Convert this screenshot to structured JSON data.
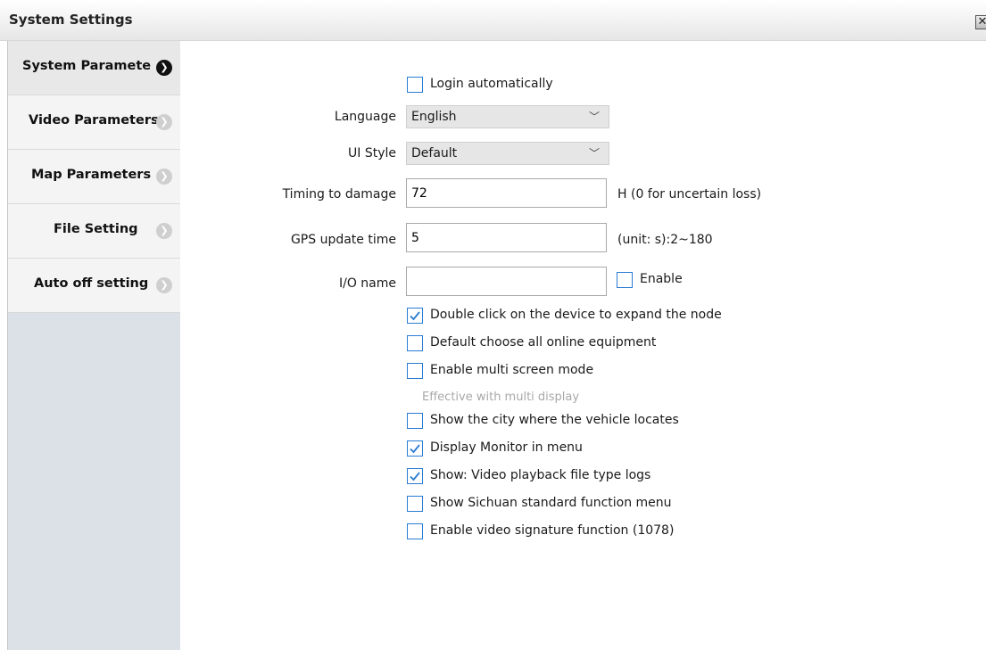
{
  "window": {
    "title": "System Settings",
    "close_glyph": "✕"
  },
  "sidebar": {
    "items": [
      {
        "label": "System Paramete",
        "active": true
      },
      {
        "label": "Video Parameters",
        "active": false
      },
      {
        "label": "Map Parameters",
        "active": false
      },
      {
        "label": "File Setting",
        "active": false
      },
      {
        "label": "Auto off setting",
        "active": false
      }
    ],
    "arrow_glyph": "❯"
  },
  "form": {
    "login_auto": {
      "label": "Login automatically",
      "checked": false
    },
    "language": {
      "label": "Language",
      "value": "English"
    },
    "ui_style": {
      "label": "UI Style",
      "value": "Default"
    },
    "timing_damage": {
      "label": "Timing to damage",
      "value": "72",
      "unit": "H (0 for uncertain loss)"
    },
    "gps_update": {
      "label": "GPS update time",
      "value": "5",
      "unit": "(unit: s):2~180"
    },
    "io_name": {
      "label": "I/O name",
      "value": "",
      "enable_label": "Enable",
      "enable_checked": false
    },
    "options": [
      {
        "label": "Double click on the device to expand the node",
        "checked": true
      },
      {
        "label": "Default choose all online equipment",
        "checked": false
      },
      {
        "label": "Enable multi screen mode",
        "checked": false
      },
      {
        "label": "Show the city where the vehicle locates",
        "checked": false
      },
      {
        "label": "Display Monitor in menu",
        "checked": true
      },
      {
        "label": "Show: Video playback file type logs",
        "checked": true
      },
      {
        "label": "Show Sichuan standard function menu",
        "checked": false
      },
      {
        "label": "Enable video signature function (1078)",
        "checked": false
      }
    ],
    "multi_display_hint": "Effective with multi display",
    "dropdown_glyph": "﹀"
  },
  "colors": {
    "checkbox_border": "#2a7cd3",
    "sidebar_bg": "#dce1e8"
  }
}
